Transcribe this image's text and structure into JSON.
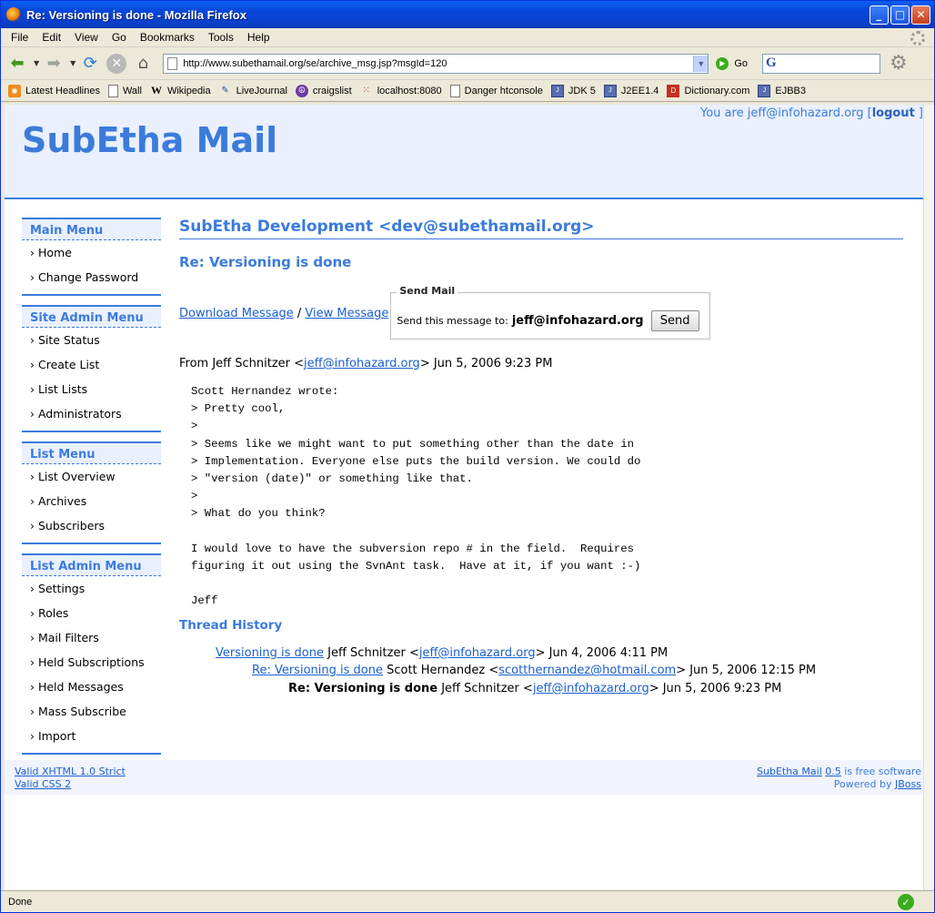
{
  "window": {
    "title": "Re: Versioning is done - Mozilla Firefox",
    "minimize": "_",
    "maximize": "□",
    "close": "✕"
  },
  "menubar": [
    "File",
    "Edit",
    "View",
    "Go",
    "Bookmarks",
    "Tools",
    "Help"
  ],
  "navbar": {
    "url": "http://www.subethamail.org/se/archive_msg.jsp?msgId=120",
    "go_label": "Go",
    "search_engine_glyph": "G"
  },
  "bookmarks": [
    "Latest Headlines",
    "Wall",
    "Wikipedia",
    "LiveJournal",
    "craigslist",
    "localhost:8080",
    "Danger htconsole",
    "JDK 5",
    "J2EE1.4",
    "Dictionary.com",
    "EJBB3"
  ],
  "page": {
    "logo": "SubEtha Mail",
    "user_prefix": "You are jeff@infohazard.org [",
    "logout": "logout",
    "user_suffix": " ]",
    "sidebar": {
      "main_menu": {
        "title": "Main Menu",
        "items": [
          "› Home",
          "› Change Password"
        ]
      },
      "site_admin_menu": {
        "title": "Site Admin Menu",
        "items": [
          "› Site Status",
          "› Create List",
          "› List Lists",
          "› Administrators"
        ]
      },
      "list_menu": {
        "title": "List Menu",
        "items": [
          "› List Overview",
          "› Archives",
          "› Subscribers"
        ]
      },
      "list_admin_menu": {
        "title": "List Admin Menu",
        "items": [
          "› Settings",
          "› Roles",
          "› Mail Filters",
          "› Held Subscriptions",
          "› Held Messages",
          "› Mass Subscribe",
          "› Import"
        ]
      }
    },
    "list_title": "SubEtha Development <dev@subethamail.org>",
    "subject": "Re: Versioning is done",
    "download_link": "Download Message",
    "separator": " / ",
    "view_link": "View Message",
    "send_mail": {
      "legend": "Send Mail",
      "label": "Send this message to:",
      "address": "jeff@infohazard.org",
      "button": "Send"
    },
    "from": {
      "prefix": "From Jeff Schnitzer <",
      "email": "jeff@infohazard.org",
      "suffix": "> Jun 5, 2006 9:23 PM"
    },
    "body": "Scott Hernandez wrote:\n> Pretty cool,\n>\n> Seems like we might want to put something other than the date in\n> Implementation. Everyone else puts the build version. We could do\n> \"version (date)\" or something like that.\n>\n> What do you think?\n\nI would love to have the subversion repo # in the field.  Requires\nfiguring it out using the SvnAnt task.  Have at it, if you want :-)\n\nJeff",
    "thread_history_title": "Thread History",
    "thread": [
      {
        "subject": "Versioning is done",
        "author": " Jeff Schnitzer <",
        "email": "jeff@infohazard.org",
        "date": "> Jun 4, 2006 4:11 PM"
      },
      {
        "subject": "Re: Versioning is done",
        "author": " Scott Hernandez <",
        "email": "scotthernandez@hotmail.com",
        "date": "> Jun 5, 2006 12:15 PM"
      },
      {
        "subject": "Re: Versioning is done",
        "author": " Jeff Schnitzer <",
        "email": "jeff@infohazard.org",
        "date": "> Jun 5, 2006 9:23 PM"
      }
    ],
    "footer": {
      "valid_xhtml": "Valid XHTML 1.0 Strict",
      "valid_css": "Valid CSS 2",
      "subetha_link": "SubEtha Mail",
      "version_link": "0.5",
      "free_text": " is free software",
      "powered_by": "Powered by ",
      "jboss_link": "JBoss"
    }
  },
  "status": {
    "text": "Done"
  },
  "colors": {
    "accent": "#3b7bdc",
    "header_bg": "#eaf0fd",
    "link": "#1a5fd0"
  }
}
